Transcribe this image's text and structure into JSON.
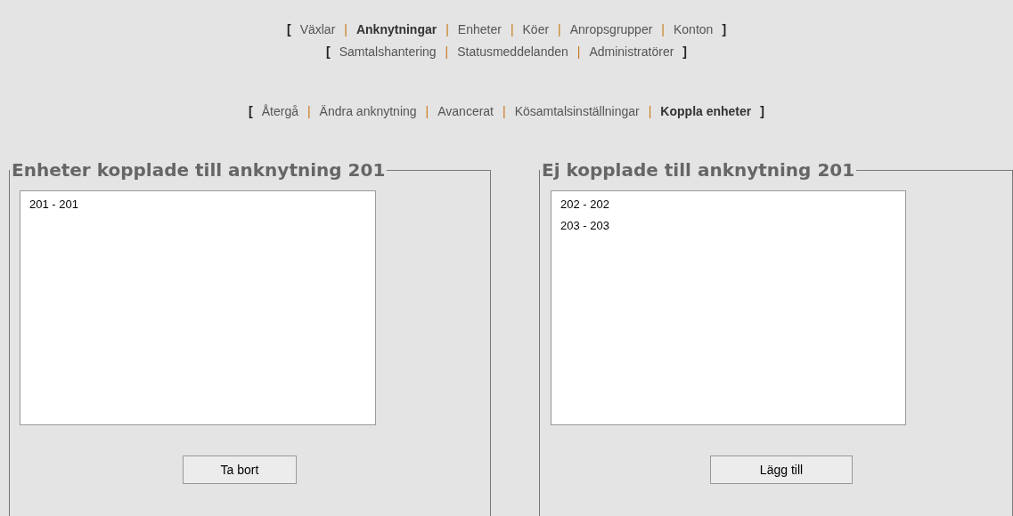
{
  "nav_rows": [
    {
      "items": [
        {
          "kind": "bracket",
          "text": "["
        },
        {
          "kind": "link",
          "text": "Växlar",
          "selected": false
        },
        {
          "kind": "separator",
          "text": "|"
        },
        {
          "kind": "link",
          "text": "Anknytningar",
          "selected": true
        },
        {
          "kind": "separator",
          "text": "|"
        },
        {
          "kind": "link",
          "text": "Enheter",
          "selected": false
        },
        {
          "kind": "separator",
          "text": "|"
        },
        {
          "kind": "link",
          "text": "Köer",
          "selected": false
        },
        {
          "kind": "separator",
          "text": "|"
        },
        {
          "kind": "link",
          "text": "Anropsgrupper",
          "selected": false
        },
        {
          "kind": "separator",
          "text": "|"
        },
        {
          "kind": "link",
          "text": "Konton",
          "selected": false
        },
        {
          "kind": "bracket",
          "text": "]"
        }
      ]
    },
    {
      "items": [
        {
          "kind": "bracket",
          "text": "["
        },
        {
          "kind": "link",
          "text": "Samtalshantering",
          "selected": false
        },
        {
          "kind": "separator",
          "text": "|"
        },
        {
          "kind": "link",
          "text": "Statusmeddelanden",
          "selected": false
        },
        {
          "kind": "separator",
          "text": "|"
        },
        {
          "kind": "link",
          "text": "Administratörer",
          "selected": false
        },
        {
          "kind": "bracket",
          "text": "]"
        }
      ]
    },
    {
      "items": [
        {
          "kind": "bracket",
          "text": "["
        },
        {
          "kind": "link",
          "text": "Återgå",
          "selected": false
        },
        {
          "kind": "separator",
          "text": "|"
        },
        {
          "kind": "link",
          "text": "Ändra anknytning",
          "selected": false
        },
        {
          "kind": "separator",
          "text": "|"
        },
        {
          "kind": "link",
          "text": "Avancerat",
          "selected": false
        },
        {
          "kind": "separator",
          "text": "|"
        },
        {
          "kind": "link",
          "text": "Kösamtalsinställningar",
          "selected": false
        },
        {
          "kind": "separator",
          "text": "|"
        },
        {
          "kind": "link",
          "text": "Koppla enheter",
          "selected": true
        },
        {
          "kind": "bracket",
          "text": "]"
        }
      ]
    }
  ],
  "panels": [
    {
      "legend": "Enheter kopplade till anknytning 201",
      "options": [
        "201 - 201"
      ],
      "button": "Ta bort"
    },
    {
      "legend": "Ej kopplade till anknytning 201",
      "options": [
        "202 - 202",
        "203 - 203"
      ],
      "button": "Lägg till"
    }
  ]
}
